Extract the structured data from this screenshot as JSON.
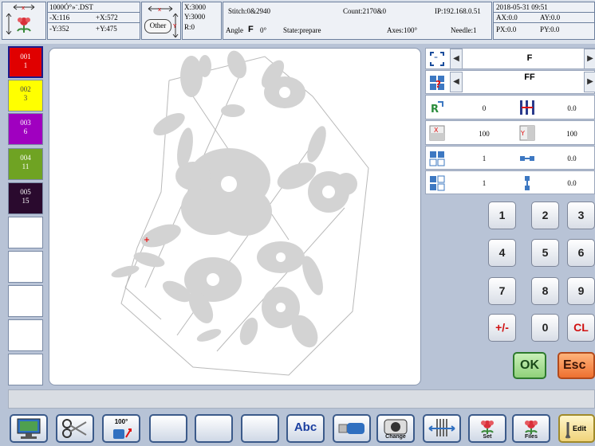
{
  "header": {
    "filename": "1000Ó°»¨.DST",
    "x_minus": "-X:116",
    "x_plus": "+X:572",
    "y_minus": "-Y:352",
    "y_plus": "+Y:475",
    "other_button": "Other",
    "pos_x": "X:3000",
    "pos_y": "Y:3000",
    "pos_r": "R:0",
    "stitch": "Stitch:0&2940",
    "count": "Count:2170&0",
    "ip": "IP:192.168.0.51",
    "angle_label": "Angle",
    "angle_letter": "F",
    "angle_value": "0°",
    "state": "State:prepare",
    "axes": "Axes:100°",
    "needle": "Needle:1",
    "datetime": "2018-05-31  09:51",
    "ax": "AX:0.0",
    "ay": "AY:0.0",
    "px": "PX:0.0",
    "py": "PY:0.0"
  },
  "colors": {
    "slots": [
      {
        "num": "001",
        "needle": "1",
        "color": "#e00000",
        "text_color": "#ffffff"
      },
      {
        "num": "002",
        "needle": "3",
        "color": "#ffff00",
        "text_color": "#444444"
      },
      {
        "num": "003",
        "needle": "6",
        "color": "#a000c0",
        "text_color": "#ffffff"
      },
      {
        "num": "004",
        "needle": "11",
        "color": "#6fa323",
        "text_color": "#ffffff"
      },
      {
        "num": "005",
        "needle": "15",
        "color": "#2a0a2e",
        "text_color": "#ffffff"
      }
    ]
  },
  "panel": {
    "frame_letter": "F",
    "direction_letters": "FF",
    "r3_left": "0",
    "r3_right": "0.0",
    "r4_left": "100",
    "r4_right": "100",
    "r5_left": "1",
    "r5_right": "0.0",
    "r6_left": "1",
    "r6_right": "0.0"
  },
  "keypad": {
    "k1": "1",
    "k2": "2",
    "k3": "3",
    "k4": "4",
    "k5": "5",
    "k6": "6",
    "k7": "7",
    "k8": "8",
    "k9": "9",
    "kpm": "+/-",
    "k0": "0",
    "kcl": "CL",
    "ok": "OK",
    "esc": "Esc"
  },
  "toolbar": {
    "speed_label": "100°",
    "abc_label": "Abc",
    "change_label": "Change",
    "set_label": "Set",
    "files_label": "Files",
    "edit_label": "Edit"
  }
}
